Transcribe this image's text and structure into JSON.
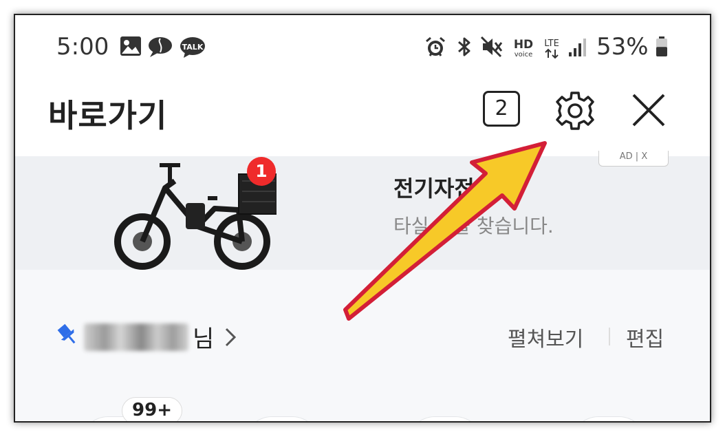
{
  "status_bar": {
    "time": "5:00",
    "notification_icons": [
      "image-icon",
      "speech-bubble-icon",
      "kakaotalk-icon"
    ],
    "kakaotalk_label": "TALK",
    "system_icons": [
      "alarm-icon",
      "bluetooth-icon",
      "mute-icon",
      "hd-voice-icon",
      "lte-icon",
      "signal-icon"
    ],
    "hd_label": "HD",
    "voice_label": "voice",
    "lte_label": "LTE",
    "battery_percent": "53%",
    "battery_level": 0.53
  },
  "header": {
    "title": "바로가기",
    "tab_count": "2",
    "settings_icon": "gear-icon",
    "close_icon": "close-icon"
  },
  "ad_banner": {
    "ad_tag": "AD | X",
    "badge_count": "1",
    "title": "전기자전",
    "subtitle": "타실 분을 찾습니다."
  },
  "user_row": {
    "username_suffix": "님",
    "expand_label": "펼쳐보기",
    "edit_label": "편집"
  },
  "apps": {
    "first_count": "99+",
    "colors": [
      "#2e8b3a",
      "#3dbf3a",
      "#1dc85a",
      "#5b3fc4"
    ]
  },
  "annotation": {
    "arrow_color": "#f7c928",
    "arrow_border": "#d31f37"
  }
}
